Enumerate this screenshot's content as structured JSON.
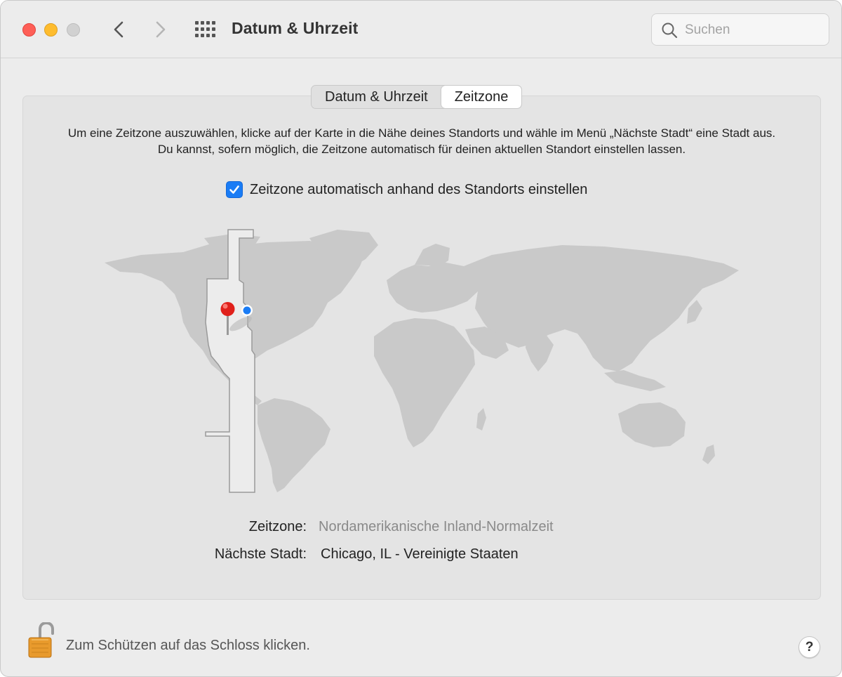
{
  "window": {
    "title": "Datum & Uhrzeit",
    "search_placeholder": "Suchen"
  },
  "tabs": [
    {
      "label": "Datum & Uhrzeit",
      "active": false
    },
    {
      "label": "Zeitzone",
      "active": true
    }
  ],
  "description": {
    "line1": "Um eine Zeitzone auszuwählen, klicke auf der Karte in die Nähe deines Standorts und wähle im Menü „Nächste Stadt“ eine Stadt aus.",
    "line2": "Du kannst, sofern möglich, die Zeitzone automatisch für deinen aktuellen Standort einstellen lassen."
  },
  "auto_timezone": {
    "label": "Zeitzone automatisch anhand des Standorts einstellen",
    "checked": true
  },
  "timezone": {
    "label": "Zeitzone:",
    "value": "Nordamerikanische Inland-Normalzeit"
  },
  "nearest_city": {
    "label": "Nächste Stadt:",
    "value": "Chicago, IL - Vereinigte Staaten"
  },
  "footer": {
    "lock_text": "Zum Schützen auf das Schloss klicken.",
    "help_label": "?"
  },
  "colors": {
    "accent": "#1a7cf5",
    "land": "#c8c8c8",
    "highlight_zone": "#ececec",
    "pin": "#e0201b"
  },
  "icons": [
    "close-light",
    "minimize-light",
    "zoom-light",
    "chevron-left-icon",
    "chevron-right-icon",
    "grid-icon",
    "search-icon",
    "checkmark-icon",
    "map-pin-icon",
    "location-dot-icon",
    "lock-open-icon",
    "help-icon"
  ]
}
